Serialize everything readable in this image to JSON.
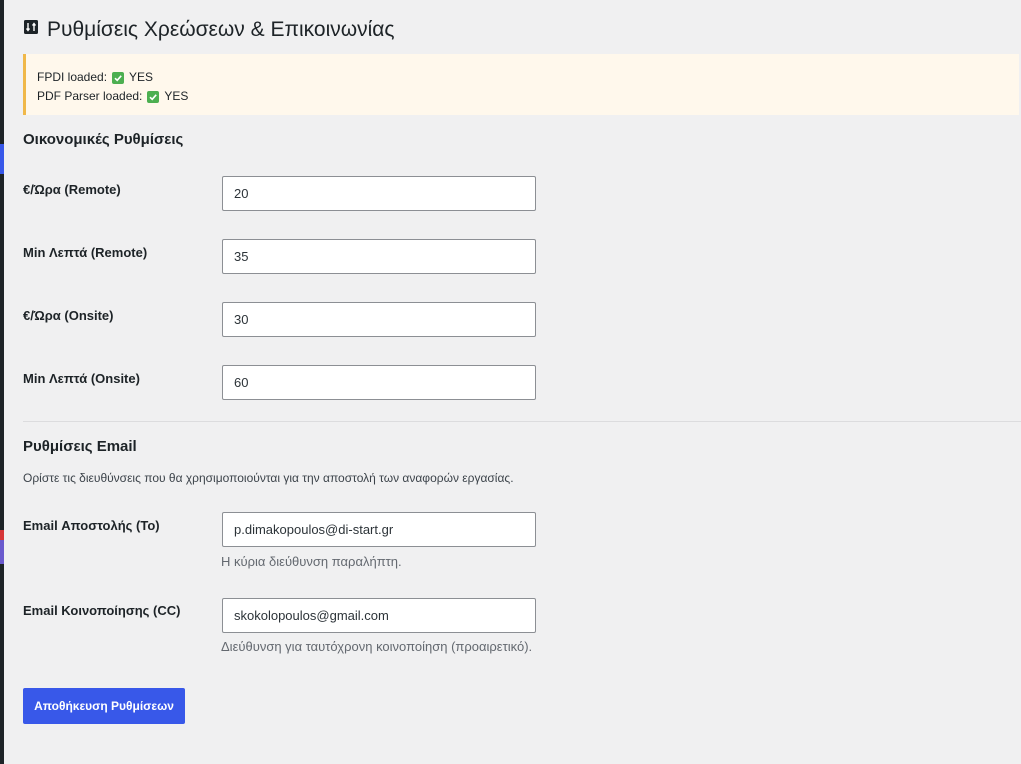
{
  "page": {
    "title": "Ρυθμίσεις Χρεώσεων & Επικοινωνίας",
    "icon": "settings-sort-icon"
  },
  "notice": {
    "fpdi_label": "FPDI loaded:",
    "fpdi_value": "YES",
    "parser_label": "PDF Parser loaded:",
    "parser_value": "YES",
    "icon": "check-mark-icon",
    "accent_color": "#f0b849"
  },
  "financial": {
    "title": "Οικονομικές Ρυθμίσεις",
    "fields": [
      {
        "label": "€/Ώρα (Remote)",
        "value": "20"
      },
      {
        "label": "Min Λεπτά (Remote)",
        "value": "35"
      },
      {
        "label": "€/Ώρα (Onsite)",
        "value": "30"
      },
      {
        "label": "Min Λεπτά (Onsite)",
        "value": "60"
      }
    ]
  },
  "email": {
    "title": "Ρυθμίσεις Email",
    "description": "Ορίστε τις διευθύνσεις που θα χρησιμοποιούνται για την αποστολή των αναφορών εργασίας.",
    "to": {
      "label": "Email Αποστολής (To)",
      "value": "p.dimakopoulos@di-start.gr",
      "help": "Η κύρια διεύθυνση παραλήπτη."
    },
    "cc": {
      "label": "Email Κοινοποίησης (CC)",
      "value": "skokolopoulos@gmail.com",
      "help": "Διεύθυνση για ταυτόχρονη κοινοποίηση (προαιρετικό)."
    }
  },
  "save_button": {
    "label": "Αποθήκευση Ρυθμίσεων",
    "color": "#3858e9"
  }
}
